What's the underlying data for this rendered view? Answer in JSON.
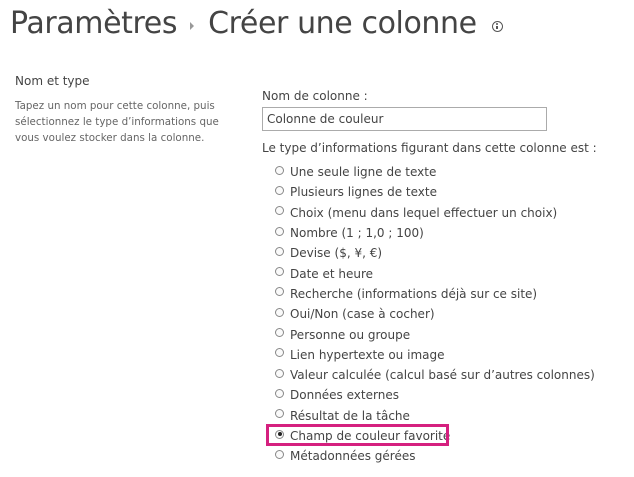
{
  "header": {
    "breadcrumb_parent": "Paramètres",
    "page_title": "Créer une colonne"
  },
  "section": {
    "title": "Nom et type",
    "description": "Tapez un nom pour cette colonne, puis sélectionnez le type d’informations que vous voulez stocker dans la colonne."
  },
  "form": {
    "column_name_label": "Nom de colonne :",
    "column_name_value": "Colonne de couleur",
    "type_label": "Le type d’informations figurant dans cette colonne est :",
    "types": [
      {
        "label": "Une seule ligne de texte",
        "checked": false
      },
      {
        "label": "Plusieurs lignes de texte",
        "checked": false
      },
      {
        "label": "Choix (menu dans lequel effectuer un choix)",
        "checked": false
      },
      {
        "label": "Nombre (1 ; 1,0 ; 100)",
        "checked": false
      },
      {
        "label": "Devise ($, ¥, €)",
        "checked": false
      },
      {
        "label": "Date et heure",
        "checked": false
      },
      {
        "label": "Recherche (informations déjà sur ce site)",
        "checked": false
      },
      {
        "label": "Oui/Non (case à cocher)",
        "checked": false
      },
      {
        "label": "Personne ou groupe",
        "checked": false
      },
      {
        "label": "Lien hypertexte ou image",
        "checked": false
      },
      {
        "label": "Valeur calculée (calcul basé sur d’autres colonnes)",
        "checked": false
      },
      {
        "label": "Données externes",
        "checked": false
      },
      {
        "label": "Résultat de la tâche",
        "checked": false
      },
      {
        "label": "Champ de couleur favorite",
        "checked": true
      },
      {
        "label": "Métadonnées gérées",
        "checked": false
      }
    ]
  },
  "colors": {
    "highlight_border": "#d5207f",
    "text": "#444444"
  },
  "icons": {
    "title_info": "info-icon",
    "breadcrumb_separator": "chevron-right-icon"
  }
}
